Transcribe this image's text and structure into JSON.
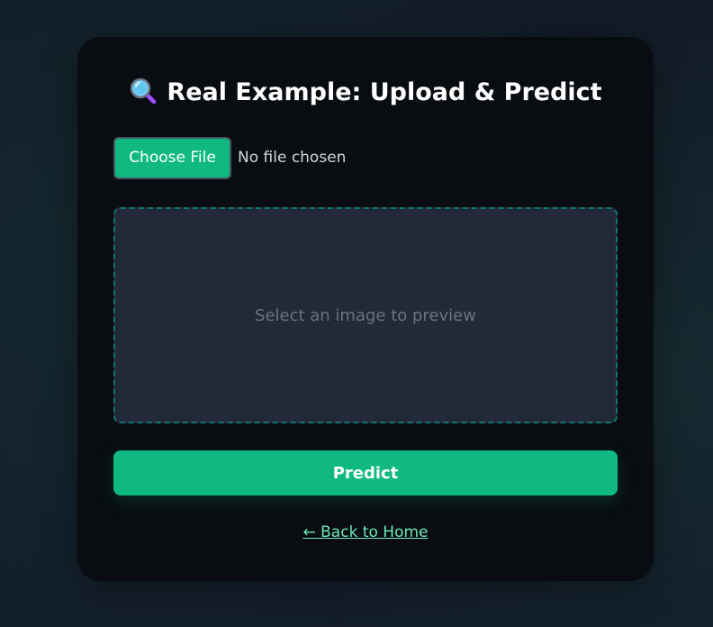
{
  "header": {
    "title": "Real Example: Upload & Predict",
    "icon": "magnifying-glass-icon"
  },
  "file_input": {
    "button_label": "Choose File",
    "status_text": "No file chosen"
  },
  "preview": {
    "placeholder": "Select an image to preview"
  },
  "actions": {
    "predict_label": "Predict",
    "back_link_label": "← Back to Home"
  },
  "colors": {
    "accent": "#10b981",
    "card_background": "#090d12",
    "preview_background": "#222a3a",
    "preview_border": "#0f766e",
    "link": "#6ee7b7"
  }
}
